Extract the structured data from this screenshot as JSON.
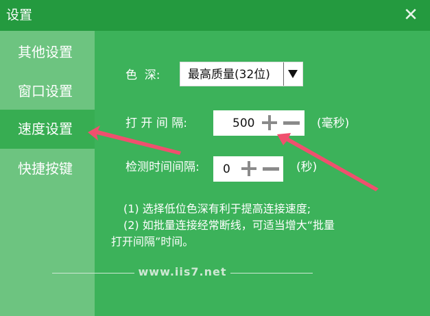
{
  "window": {
    "title": "设置",
    "close_icon": "close-icon"
  },
  "sidebar": {
    "items": [
      {
        "label": "其他设置",
        "active": false
      },
      {
        "label": "窗口设置",
        "active": false
      },
      {
        "label": "速度设置",
        "active": true
      },
      {
        "label": "快捷按键",
        "active": false
      }
    ]
  },
  "settings": {
    "color_depth": {
      "label": "色  深:",
      "selected": "最高质量(32位)",
      "dropdown_icon": "dropdown-arrow-icon"
    },
    "open_interval": {
      "label": "打 开 间 隔:",
      "value": "500",
      "unit": "(毫秒)",
      "plus_icon": "plus-icon",
      "minus_icon": "minus-icon"
    },
    "detect_interval": {
      "label": "检测时间间隔:",
      "value": "0",
      "unit": "(秒)",
      "plus_icon": "plus-icon",
      "minus_icon": "minus-icon"
    },
    "notes": [
      "(1) 选择低位色深有利于提高连接速度;",
      "(2) 如批量连接经常断线，可适当增大“批量",
      "打开间隔”时间。"
    ]
  },
  "watermark": "www.iis7.net",
  "colors": {
    "title_green": "#249a3f",
    "side_green": "#6dc480",
    "active_green": "#37ad52",
    "main_green": "#3cb25a",
    "annotation_red": "#f0506e"
  }
}
